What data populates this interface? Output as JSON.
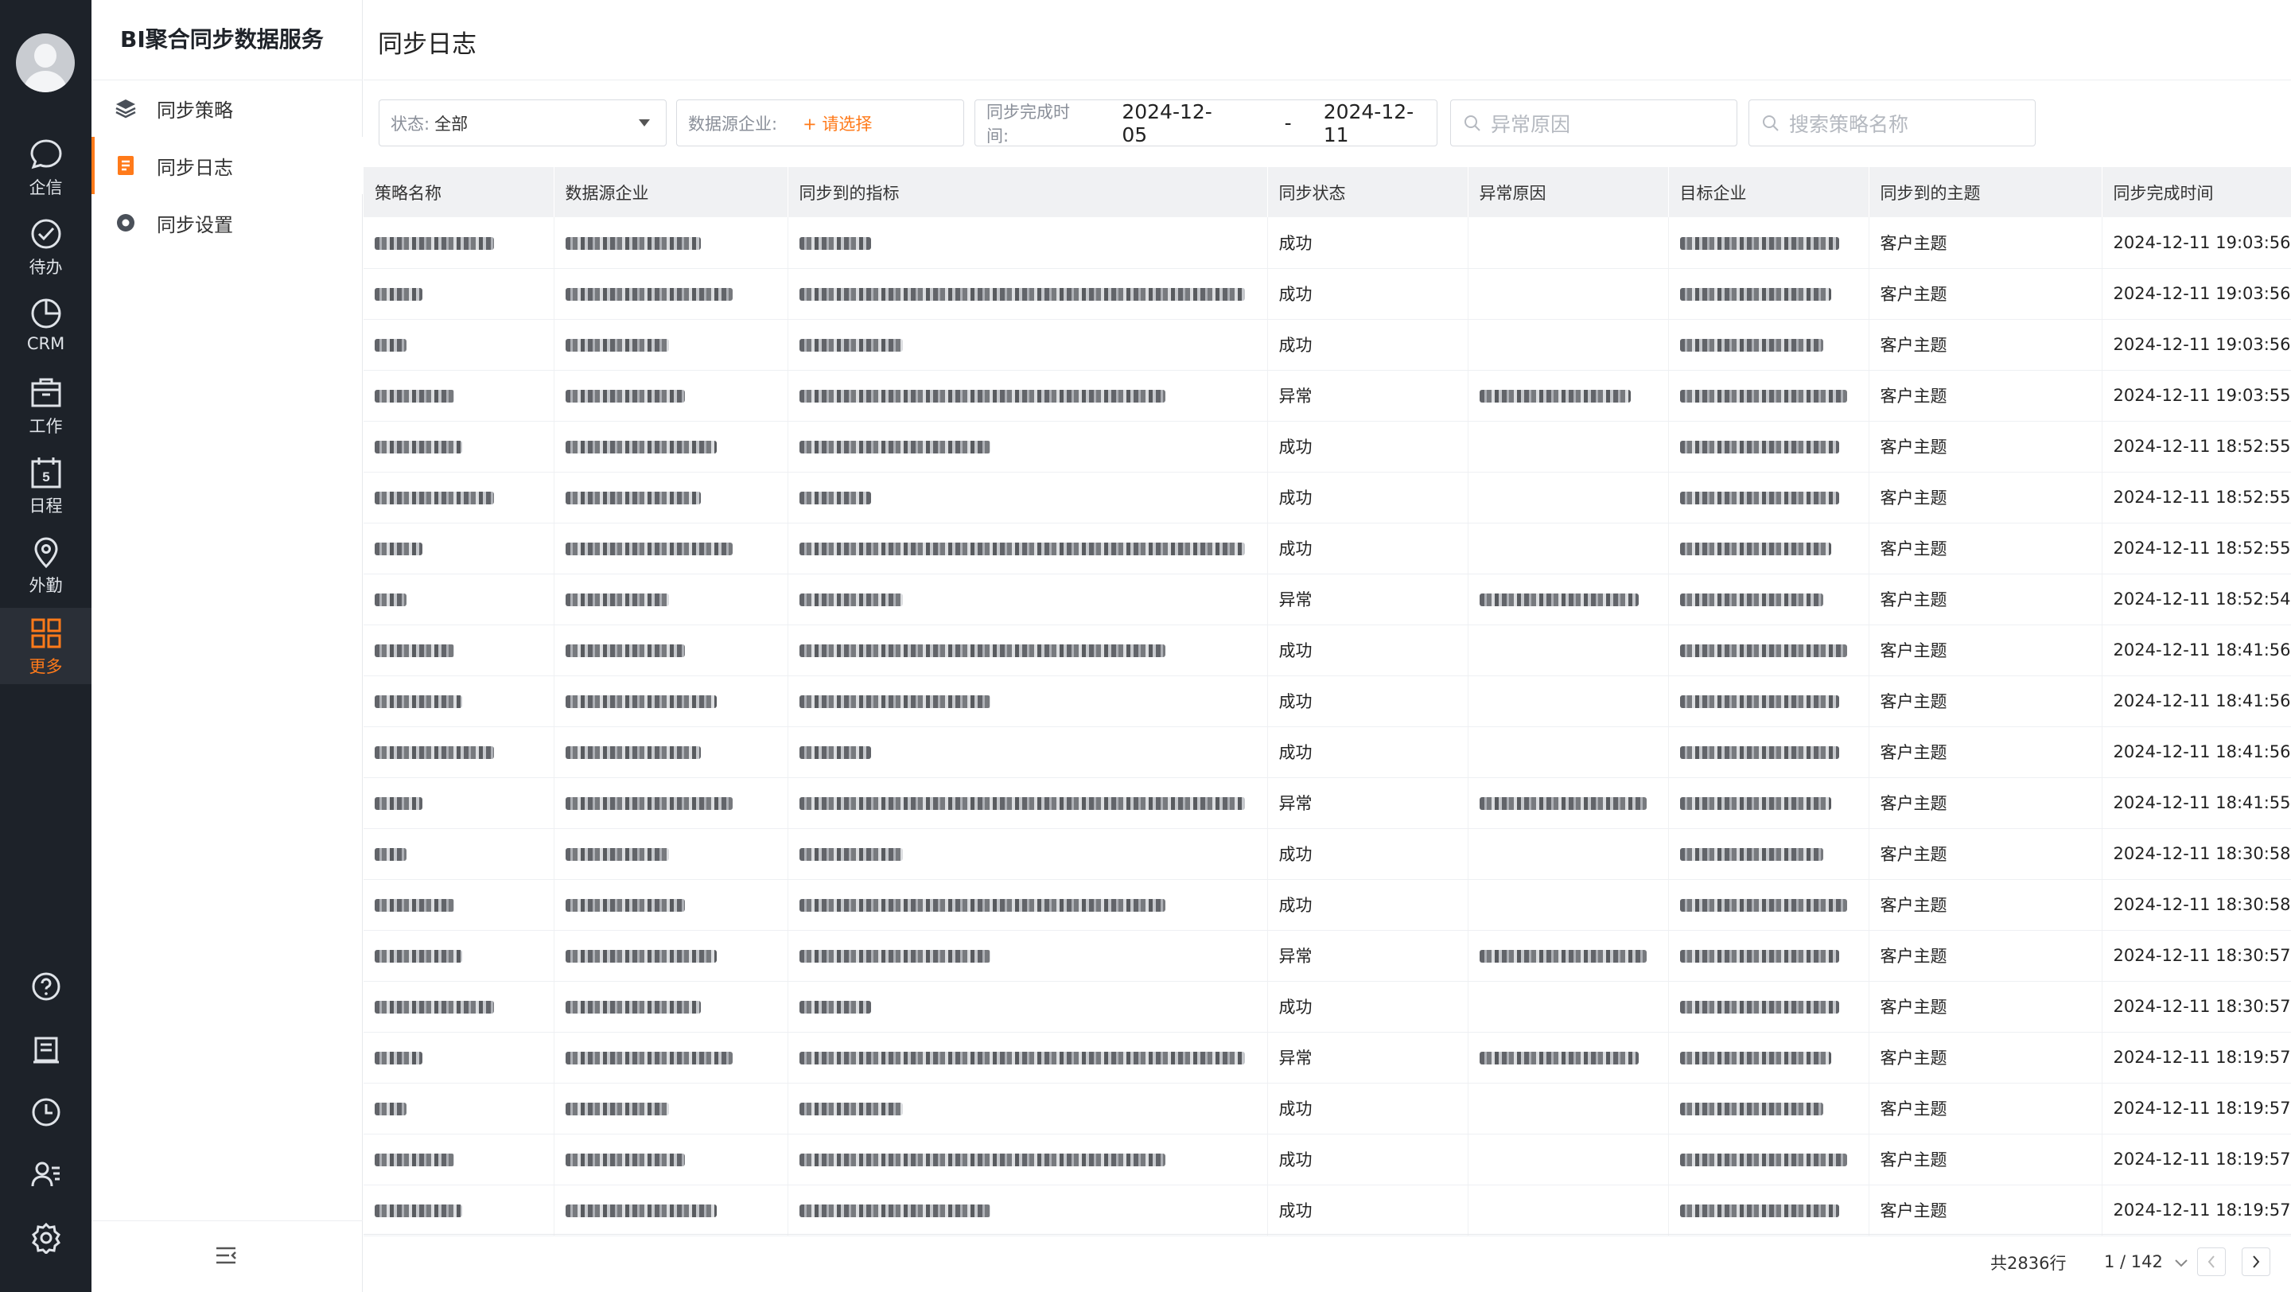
{
  "nav": {
    "items": [
      {
        "label": "企信",
        "icon": "chat-icon"
      },
      {
        "label": "待办",
        "icon": "check-circle-icon"
      },
      {
        "label": "CRM",
        "icon": "pie-chart-icon"
      },
      {
        "label": "工作",
        "icon": "briefcase-icon"
      },
      {
        "label": "日程",
        "icon": "calendar-icon",
        "day": "5"
      },
      {
        "label": "外勤",
        "icon": "location-icon"
      },
      {
        "label": "更多",
        "icon": "grid-icon"
      }
    ],
    "bottom_icons": [
      "help-icon",
      "notes-icon",
      "clock-icon",
      "contacts-icon",
      "settings-icon"
    ],
    "accent": "#ff7a1a"
  },
  "sidebar": {
    "title": "BI聚合同步数据服务",
    "items": [
      {
        "label": "同步策略",
        "icon": "layers-icon"
      },
      {
        "label": "同步日志",
        "icon": "log-icon"
      },
      {
        "label": "同步设置",
        "icon": "gear-icon"
      }
    ]
  },
  "page": {
    "title": "同步日志"
  },
  "filters": {
    "status_label": "状态:",
    "status_value": "全部",
    "source_label": "数据源企业:",
    "source_value": "+ 请选择",
    "time_label": "同步完成时间:",
    "date_from": "2024-12-05",
    "date_sep": "-",
    "date_to": "2024-12-11",
    "reason_placeholder": "异常原因",
    "strategy_placeholder": "搜索策略名称"
  },
  "table": {
    "columns": [
      "策略名称",
      "数据源企业",
      "同步到的指标",
      "同步状态",
      "异常原因",
      "目标企业",
      "同步到的主题",
      "同步完成时间"
    ],
    "rows": [
      {
        "status": "成功",
        "theme": "客户主题",
        "time": "2024-12-11 19:03:56"
      },
      {
        "status": "成功",
        "theme": "客户主题",
        "time": "2024-12-11 19:03:56"
      },
      {
        "status": "成功",
        "theme": "客户主题",
        "time": "2024-12-11 19:03:56"
      },
      {
        "status": "异常",
        "theme": "客户主题",
        "time": "2024-12-11 19:03:55"
      },
      {
        "status": "成功",
        "theme": "客户主题",
        "time": "2024-12-11 18:52:55"
      },
      {
        "status": "成功",
        "theme": "客户主题",
        "time": "2024-12-11 18:52:55"
      },
      {
        "status": "成功",
        "theme": "客户主题",
        "time": "2024-12-11 18:52:55"
      },
      {
        "status": "异常",
        "theme": "客户主题",
        "time": "2024-12-11 18:52:54"
      },
      {
        "status": "成功",
        "theme": "客户主题",
        "time": "2024-12-11 18:41:56"
      },
      {
        "status": "成功",
        "theme": "客户主题",
        "time": "2024-12-11 18:41:56"
      },
      {
        "status": "成功",
        "theme": "客户主题",
        "time": "2024-12-11 18:41:56"
      },
      {
        "status": "异常",
        "theme": "客户主题",
        "time": "2024-12-11 18:41:55"
      },
      {
        "status": "成功",
        "theme": "客户主题",
        "time": "2024-12-11 18:30:58"
      },
      {
        "status": "成功",
        "theme": "客户主题",
        "time": "2024-12-11 18:30:58"
      },
      {
        "status": "异常",
        "theme": "客户主题",
        "time": "2024-12-11 18:30:57"
      },
      {
        "status": "成功",
        "theme": "客户主题",
        "time": "2024-12-11 18:30:57"
      },
      {
        "status": "异常",
        "theme": "客户主题",
        "time": "2024-12-11 18:19:57"
      },
      {
        "status": "成功",
        "theme": "客户主题",
        "time": "2024-12-11 18:19:57"
      },
      {
        "status": "成功",
        "theme": "客户主题",
        "time": "2024-12-11 18:19:57"
      },
      {
        "status": "成功",
        "theme": "客户主题",
        "time": "2024-12-11 18:19:57"
      }
    ]
  },
  "pager": {
    "total": "共2836行",
    "page": "1 / 142"
  }
}
